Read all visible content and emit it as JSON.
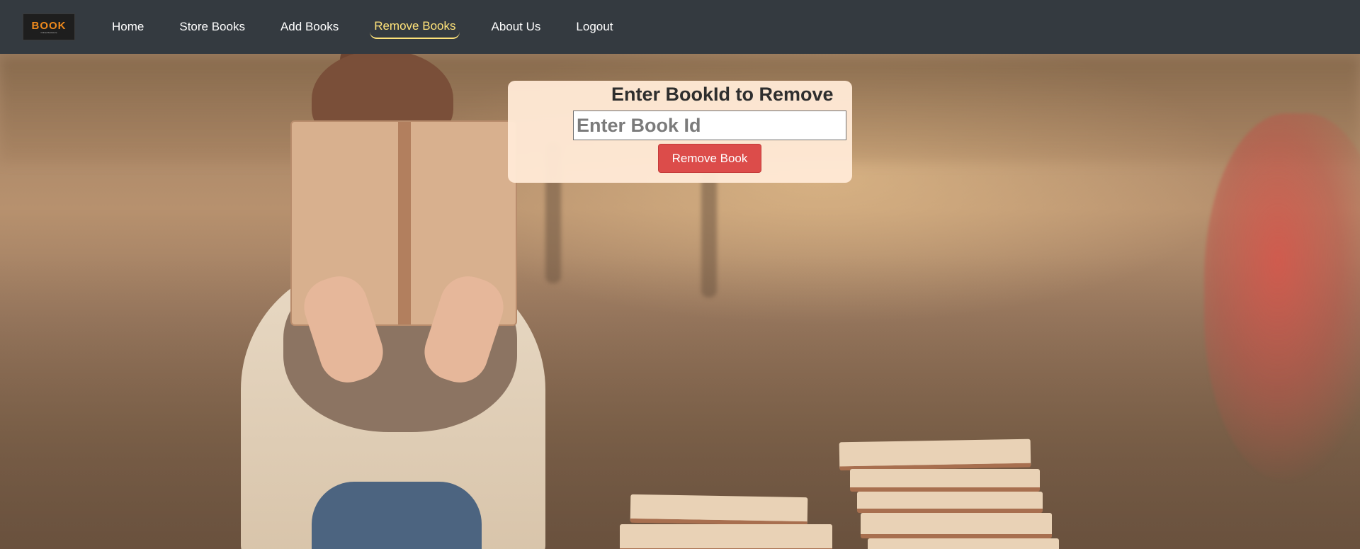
{
  "navbar": {
    "logo": {
      "text": "BOOK",
      "tagline": "Online Bookstore"
    },
    "links": [
      {
        "label": "Home"
      },
      {
        "label": "Store Books"
      },
      {
        "label": "Add Books"
      },
      {
        "label": "Remove Books",
        "active": true
      },
      {
        "label": "About Us"
      },
      {
        "label": "Logout"
      }
    ],
    "active_color": "#ffe37a",
    "background": "#343a40"
  },
  "remove_form": {
    "title": "Enter BookId to Remove",
    "input_placeholder": "Enter Book Id",
    "input_value": "",
    "button_label": "Remove Book",
    "button_color": "#dc4c4a",
    "card_color": "#ffe9d5"
  }
}
